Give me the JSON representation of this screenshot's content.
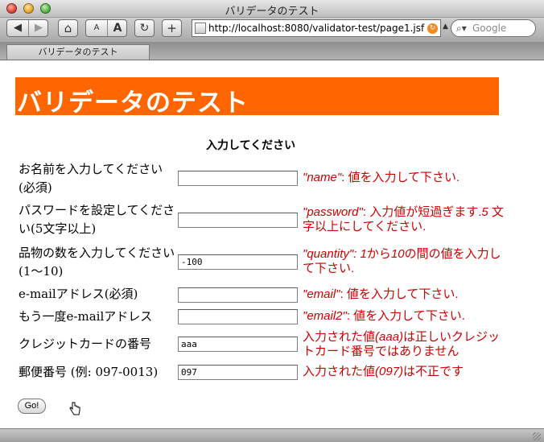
{
  "window": {
    "title": "バリデータのテスト"
  },
  "toolbar": {
    "back_label": "◀",
    "forward_label": "▶",
    "home_label": "⌂",
    "text_smaller_label": "A",
    "text_bigger_label": "A",
    "reload_label": "↻",
    "add_bookmark_label": "+",
    "url": "http://localhost:8080/validator-test/page1.jsf",
    "search_placeholder": "Google"
  },
  "tab": {
    "label": "バリデータのテスト"
  },
  "page": {
    "heading": "バリデータのテスト",
    "prompt": "入力してください",
    "fields": [
      {
        "label": "お名前を入力してください(必須)",
        "value": "",
        "error": [
          {
            "t": "\"name\"",
            "i": true
          },
          {
            "t": ": 値を入力して下さい.",
            "i": false
          }
        ]
      },
      {
        "label": "パスワードを設定してください(5文字以上)",
        "value": "",
        "error": [
          {
            "t": "\"password\"",
            "i": true
          },
          {
            "t": ": 入力値が短過ぎます.",
            "i": false
          },
          {
            "t": "5",
            "i": true
          },
          {
            "t": " 文字以上にしてください.",
            "i": false
          }
        ]
      },
      {
        "label": "品物の数を入力してください(1〜10)",
        "value": "-100",
        "error": [
          {
            "t": "\"quantity\"",
            "i": true
          },
          {
            "t": ": 1",
            "i": true
          },
          {
            "t": "から",
            "i": false
          },
          {
            "t": "10",
            "i": true
          },
          {
            "t": "の間の値を入力して下さい.",
            "i": false
          }
        ]
      },
      {
        "label": "e-mailアドレス(必須)",
        "value": "",
        "error": [
          {
            "t": "\"email\"",
            "i": true
          },
          {
            "t": ": 値を入力して下さい.",
            "i": false
          }
        ]
      },
      {
        "label": "もう一度e-mailアドレス",
        "value": "",
        "error": [
          {
            "t": "\"email2\"",
            "i": true
          },
          {
            "t": ": 値を入力して下さい.",
            "i": false
          }
        ]
      },
      {
        "label": "クレジットカードの番号",
        "value": "aaa",
        "error": [
          {
            "t": "入力された値",
            "i": false
          },
          {
            "t": "(aaa)",
            "i": true
          },
          {
            "t": "は正しいクレジットカード番号ではありません",
            "i": false
          }
        ]
      },
      {
        "label": "郵便番号 (例: 097-0013)",
        "value": "097",
        "error": [
          {
            "t": "入力された値",
            "i": false
          },
          {
            "t": "(097)",
            "i": true
          },
          {
            "t": "は不正です",
            "i": false
          }
        ]
      }
    ],
    "submit_label": "Go!"
  }
}
